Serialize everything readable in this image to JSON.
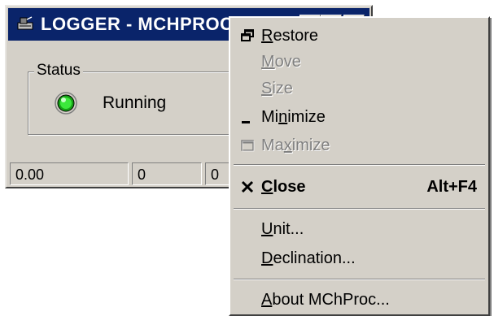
{
  "window": {
    "title": "LOGGER - MCHPROC",
    "group_label": "Status",
    "status_text": "Running",
    "status_panels": [
      "0.00",
      "0",
      "0"
    ],
    "colors": {
      "titlebar": "#0a246a",
      "face": "#d4d0c8",
      "led": "#22dd22"
    }
  },
  "menu": {
    "items": [
      {
        "pre": "",
        "u": "R",
        "post": "estore",
        "icon": "restore-icon",
        "disabled": false
      },
      {
        "pre": "",
        "u": "M",
        "post": "ove",
        "icon": "",
        "disabled": true
      },
      {
        "pre": "",
        "u": "S",
        "post": "ize",
        "icon": "",
        "disabled": true
      },
      {
        "pre": "Mi",
        "u": "n",
        "post": "imize",
        "icon": "minimize-icon",
        "disabled": false
      },
      {
        "pre": "Ma",
        "u": "x",
        "post": "imize",
        "icon": "maximize-icon",
        "disabled": true
      },
      {
        "pre": "",
        "u": "C",
        "post": "lose",
        "icon": "close-icon",
        "disabled": false,
        "accel": "Alt+F4"
      },
      {
        "pre": "",
        "u": "U",
        "post": "nit...",
        "icon": "",
        "disabled": false
      },
      {
        "pre": "",
        "u": "D",
        "post": "eclination...",
        "icon": "",
        "disabled": false
      },
      {
        "pre": "",
        "u": "A",
        "post": "bout MChProc...",
        "icon": "",
        "disabled": false
      }
    ]
  }
}
